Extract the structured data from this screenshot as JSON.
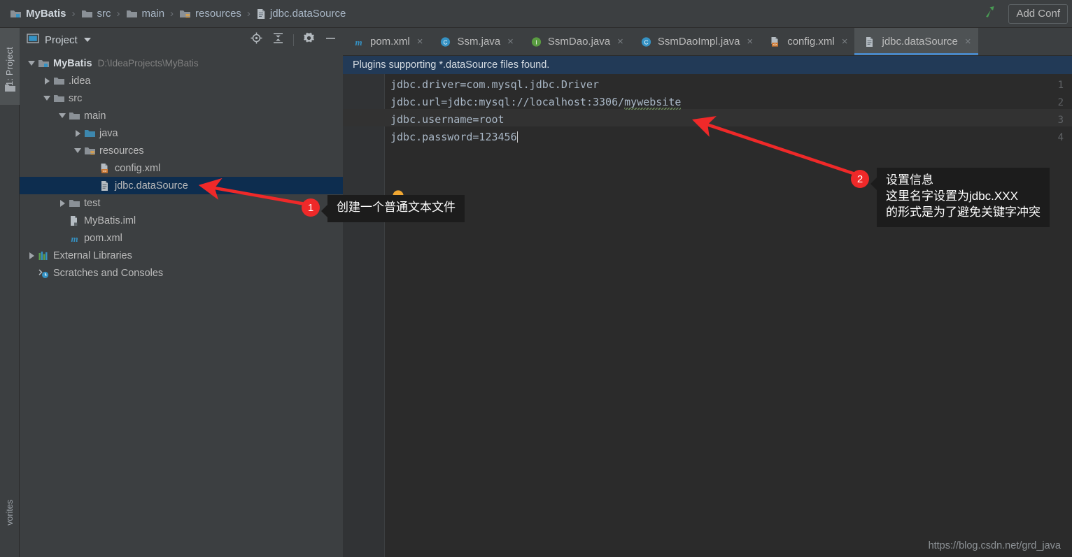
{
  "window": {
    "breadcrumb": [
      {
        "label": "MyBatis",
        "icon": "module-icon",
        "bold": true
      },
      {
        "label": "src",
        "icon": "folder-icon",
        "bold": false
      },
      {
        "label": "main",
        "icon": "folder-icon",
        "bold": false
      },
      {
        "label": "resources",
        "icon": "resources-folder-icon",
        "bold": false
      },
      {
        "label": "jdbc.dataSource",
        "icon": "file-icon",
        "bold": false
      }
    ],
    "separator": "›",
    "build_icon": "hammer-icon",
    "add_config_label": "Add Conf"
  },
  "left_strip": {
    "project_tab_label": "1: Project",
    "project_tab_icon": "project-folder-icon",
    "favorites_tab_label": "vorites"
  },
  "project_panel": {
    "title": "Project",
    "title_icon": "project-view-icon",
    "dropdown_icon": "chevron-down-icon",
    "tools": [
      {
        "name": "locate-icon",
        "label": "Select Opened File"
      },
      {
        "name": "collapse-all-icon",
        "label": "Collapse All"
      },
      {
        "name": "gear-icon",
        "label": "Settings"
      },
      {
        "name": "minimize-icon",
        "label": "Hide"
      }
    ],
    "tree": [
      {
        "label": "MyBatis",
        "path": "D:\\IdeaProjects\\MyBatis",
        "indent": 0,
        "twisty": "down",
        "icon": "module-icon",
        "bold": true,
        "selected": false
      },
      {
        "label": ".idea",
        "path": "",
        "indent": 1,
        "twisty": "right",
        "icon": "folder-icon",
        "bold": false,
        "selected": false
      },
      {
        "label": "src",
        "path": "",
        "indent": 1,
        "twisty": "down",
        "icon": "folder-icon",
        "bold": false,
        "selected": false
      },
      {
        "label": "main",
        "path": "",
        "indent": 2,
        "twisty": "down",
        "icon": "folder-icon",
        "bold": false,
        "selected": false
      },
      {
        "label": "java",
        "path": "",
        "indent": 3,
        "twisty": "right",
        "icon": "source-folder-icon",
        "bold": false,
        "selected": false
      },
      {
        "label": "resources",
        "path": "",
        "indent": 3,
        "twisty": "down",
        "icon": "resources-folder-icon",
        "bold": false,
        "selected": false
      },
      {
        "label": "config.xml",
        "path": "",
        "indent": 4,
        "twisty": "none",
        "icon": "xml-file-icon",
        "bold": false,
        "selected": false
      },
      {
        "label": "jdbc.dataSource",
        "path": "",
        "indent": 4,
        "twisty": "none",
        "icon": "file-icon",
        "bold": false,
        "selected": true
      },
      {
        "label": "test",
        "path": "",
        "indent": 2,
        "twisty": "right",
        "icon": "folder-icon",
        "bold": false,
        "selected": false
      },
      {
        "label": "MyBatis.iml",
        "path": "",
        "indent": 2,
        "twisty": "none",
        "icon": "iml-file-icon",
        "bold": false,
        "selected": false
      },
      {
        "label": "pom.xml",
        "path": "",
        "indent": 2,
        "twisty": "none",
        "icon": "maven-icon",
        "bold": false,
        "selected": false
      },
      {
        "label": "External Libraries",
        "path": "",
        "indent": 0,
        "twisty": "right",
        "icon": "libraries-icon",
        "bold": false,
        "selected": false
      },
      {
        "label": "Scratches and Consoles",
        "path": "",
        "indent": 0,
        "twisty": "none",
        "icon": "scratches-icon",
        "bold": false,
        "selected": false
      }
    ]
  },
  "editor": {
    "tabs": [
      {
        "label": "pom.xml",
        "icon": "maven-icon",
        "active": false,
        "close": "×"
      },
      {
        "label": "Ssm.java",
        "icon": "class-icon",
        "active": false,
        "close": "×"
      },
      {
        "label": "SsmDao.java",
        "icon": "interface-icon",
        "active": false,
        "close": "×"
      },
      {
        "label": "SsmDaoImpl.java",
        "icon": "class-icon",
        "active": false,
        "close": "×"
      },
      {
        "label": "config.xml",
        "icon": "xml-file-icon",
        "active": false,
        "close": "×"
      },
      {
        "label": "jdbc.dataSource",
        "icon": "file-icon",
        "active": true,
        "close": "×"
      }
    ],
    "notification": "Plugins supporting *.dataSource files found.",
    "line_numbers": [
      "1",
      "2",
      "3",
      "4"
    ],
    "lines": [
      {
        "text": "jdbc.driver=com.mysql.jdbc.Driver"
      },
      {
        "pre": "jdbc.url=jdbc:mysql://localhost:3306/",
        "typo": "mywebsite"
      },
      {
        "text": "jdbc.username=root"
      },
      {
        "text": "jdbc.password=123456"
      }
    ],
    "bulb_icon": "intention-bulb-icon",
    "watermark": "https://blog.csdn.net/grd_java"
  },
  "annotations": [
    {
      "number": "1",
      "lines": [
        "创建一个普通文本文件"
      ]
    },
    {
      "number": "2",
      "lines": [
        "设置信息",
        "这里名字设置为jdbc.XXX",
        "的形式是为了避免关键字冲突"
      ]
    }
  ],
  "colors": {
    "panel_bg": "#3c3f41",
    "editor_bg": "#2b2b2b",
    "gutter_bg": "#313335",
    "notification_bg": "#223a57",
    "selection_bg": "#0d2d4f",
    "tab_active_bg": "#4e5254",
    "tab_underline": "#4a88c7",
    "annotation_red": "#ef2929",
    "code_text": "#a9b7c6",
    "typo_underline": "#6a8759"
  }
}
